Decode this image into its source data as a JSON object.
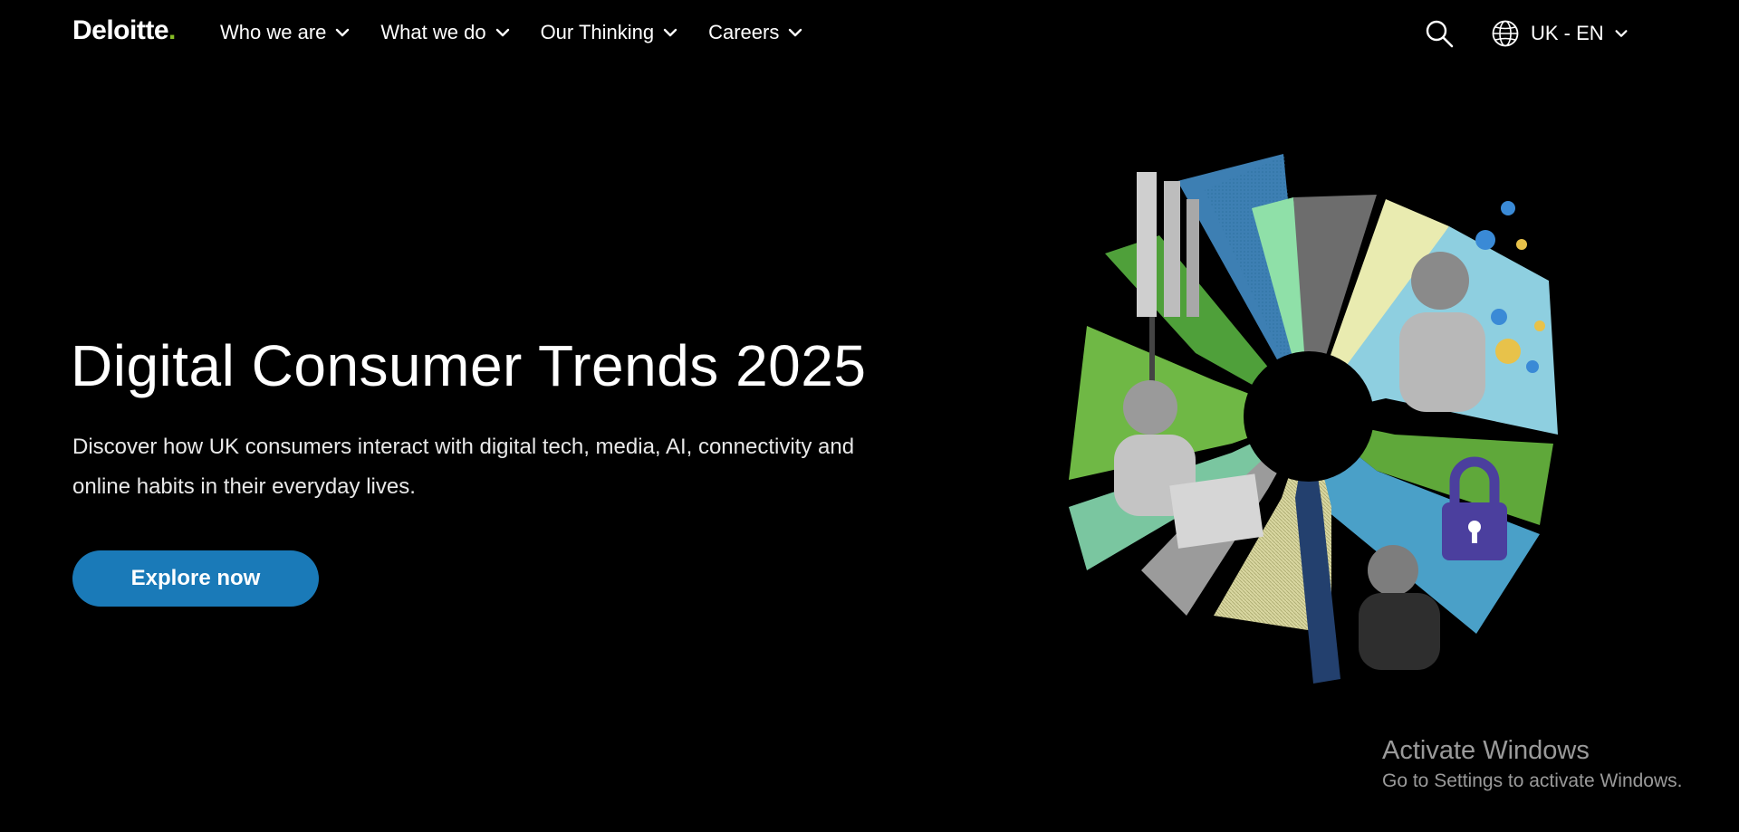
{
  "header": {
    "logo": {
      "text": "Deloitte",
      "dot": "."
    },
    "nav": [
      {
        "label": "Who we are"
      },
      {
        "label": "What we do"
      },
      {
        "label": "Our Thinking"
      },
      {
        "label": "Careers"
      }
    ],
    "search_icon": "search-icon",
    "language": {
      "label": "UK - EN",
      "icon": "globe-icon"
    }
  },
  "hero": {
    "title": "Digital Consumer Trends 2025",
    "description": "Discover how UK consumers interact with digital tech, media, AI, connectivity and online habits in their everyday lives.",
    "cta_label": "Explore now"
  },
  "watermark": {
    "title": "Activate Windows",
    "subtitle": "Go to Settings to activate Windows."
  },
  "colors": {
    "background": "#000000",
    "brand_green": "#86bc25",
    "cta_blue": "#1a7ab8",
    "text": "#ffffff",
    "watermark": "#9a9a9a"
  }
}
